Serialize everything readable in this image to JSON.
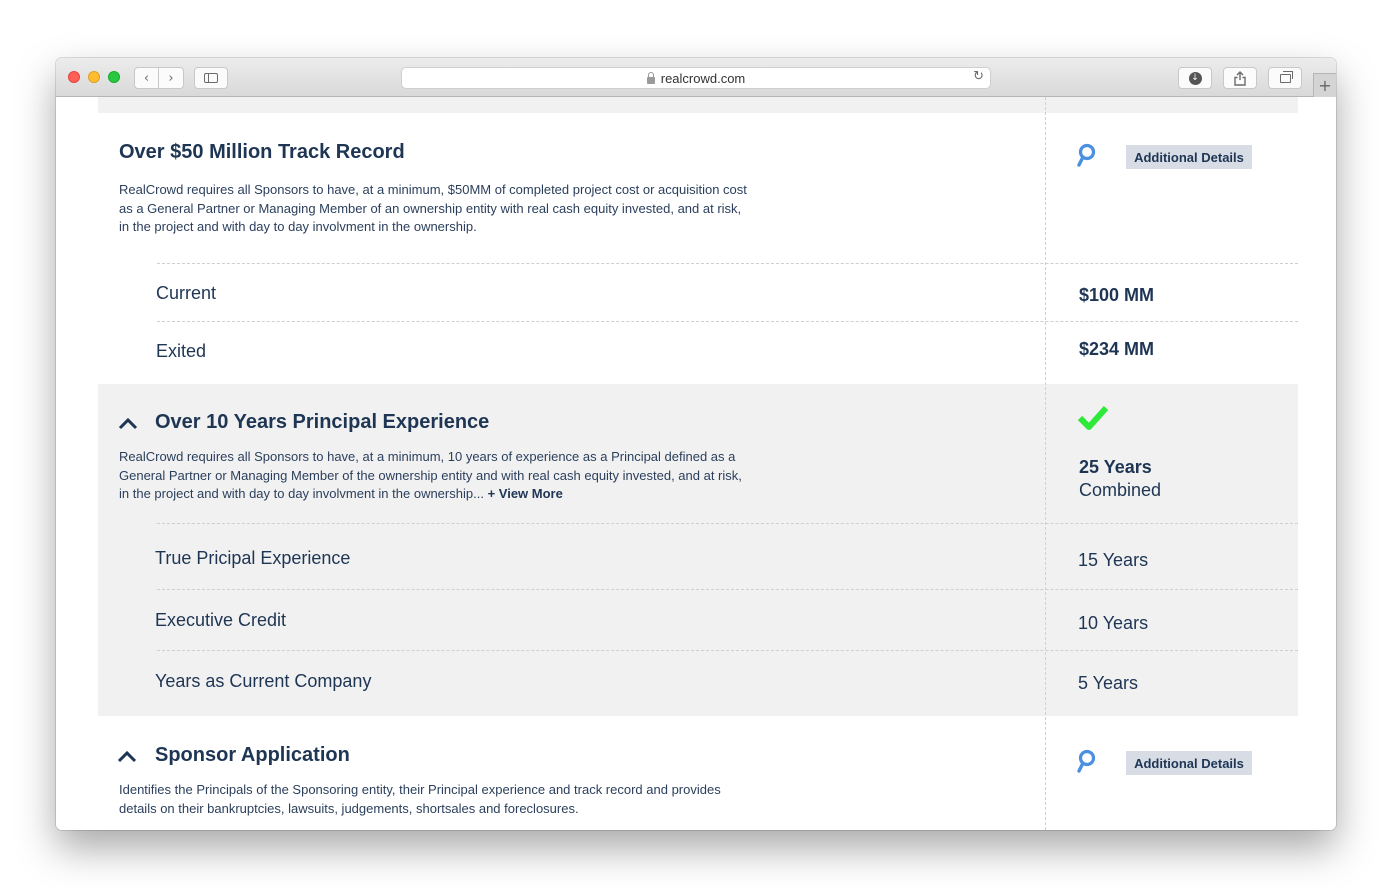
{
  "browser": {
    "url": "realcrowd.com"
  },
  "sections": {
    "track_record": {
      "title": "Over $50 Million Track Record",
      "description": "RealCrowd requires all Sponsors to have, at a minimum, $50MM of completed project cost or acquisition cost as a General Partner or Managing Member of an ownership entity with real cash equity invested, and at risk, in the project and with day to day involvment in the ownership.",
      "details_button": "Additional Details",
      "rows": [
        {
          "label": "Current",
          "value": "$100 MM"
        },
        {
          "label": "Exited",
          "value": "$234 MM"
        }
      ]
    },
    "principal_experience": {
      "title": "Over 10 Years Principal Experience",
      "description": "RealCrowd requires all Sponsors to have, at a minimum, 10 years of experience as a Principal defined as a General Partner or Managing Member of the ownership entity and with real cash equity invested, and at risk, in the project and with day to day involvment in the ownership...",
      "view_more": "+ View More",
      "summary_value": "25 Years",
      "summary_caption": "Combined",
      "rows": [
        {
          "label": "True Pricipal Experience",
          "value": "15 Years"
        },
        {
          "label": "Executive Credit",
          "value": "10 Years"
        },
        {
          "label": "Years as Current Company",
          "value": "5 Years"
        }
      ]
    },
    "sponsor_application": {
      "title": "Sponsor Application",
      "description": "Identifies the Principals of the Sponsoring entity, their Principal experience and track record and provides details on their bankruptcies, lawsuits, judgements, shortsales and foreclosures.",
      "details_button": "Additional Details"
    }
  },
  "colors": {
    "heading": "#1e3554",
    "accent_blue": "#4a8fe0",
    "check_green": "#2ee83a",
    "gray_band": "#f1f1f1",
    "button_bg": "#d8dde5"
  }
}
